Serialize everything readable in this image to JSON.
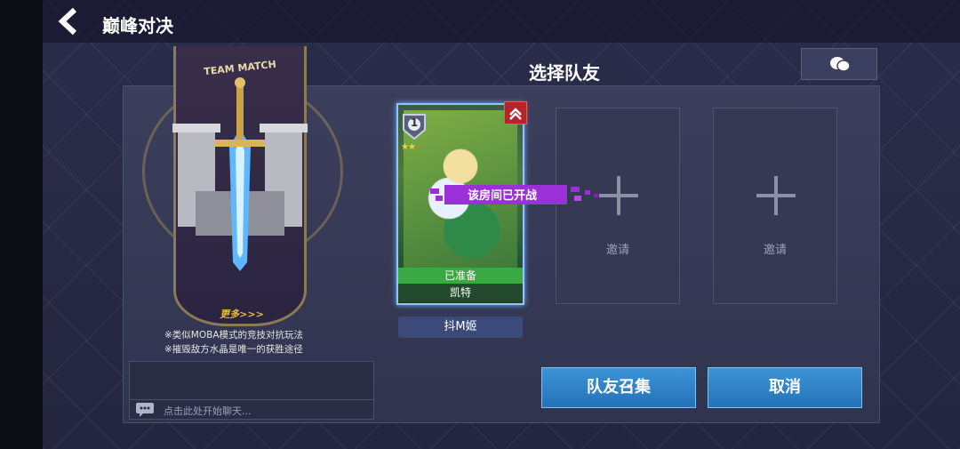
{
  "header": {
    "back_icon": "back-arrow-icon",
    "title": "巅峰对决"
  },
  "panel": {
    "title": "选择队友",
    "chat_toggle_icon": "chat-bubbles-icon"
  },
  "mode_banner": {
    "title": "TEAM MATCH",
    "more_link": "更多>>>",
    "notes": [
      "※类似MOBA模式的竞技对抗玩法",
      "※摧毁敌方水晶是唯一的获胜途径"
    ]
  },
  "chat": {
    "placeholder": "点击此处开始聊天...",
    "icon": "chat-icon"
  },
  "teammates": [
    {
      "status": "已准备",
      "hero": "凯特",
      "player": "抖M姬",
      "level": "1",
      "stars": "★★"
    }
  ],
  "status_overlay": "该房间已开战",
  "slots": [
    {
      "label": "邀请"
    },
    {
      "label": "邀请"
    }
  ],
  "buttons": {
    "summon": "队友召集",
    "cancel": "取消"
  },
  "colors": {
    "accent_blue": "#2c82c9",
    "ready_green": "#3aa843",
    "overlay_purple": "#9b2fd8"
  }
}
